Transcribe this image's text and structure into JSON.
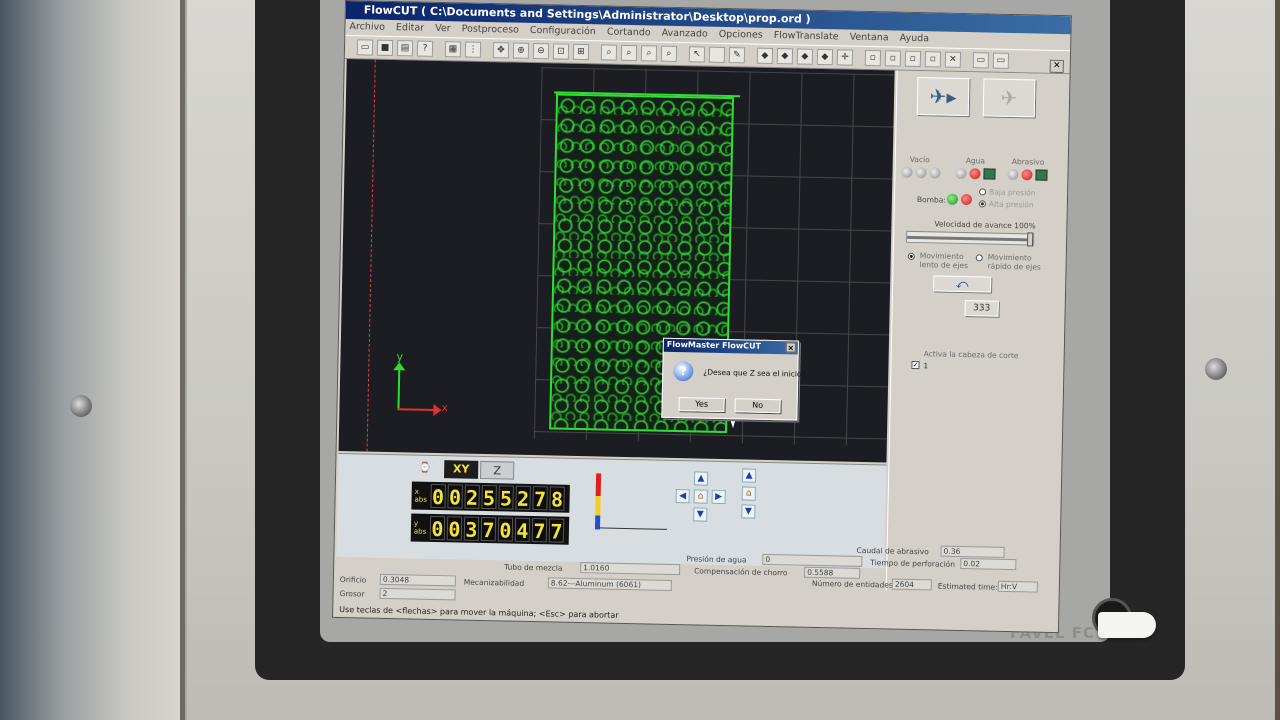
{
  "app": {
    "title": "FlowCUT ( C:\\Documents and Settings\\Administrator\\Desktop\\prop.ord )"
  },
  "menu": [
    "Archivo",
    "Editar",
    "Ver",
    "Postproceso",
    "Configuración",
    "Cortando",
    "Avanzado",
    "Opciones",
    "FlowTranslate",
    "Ventana",
    "Ayuda"
  ],
  "canvas": {
    "axis_y": "y",
    "axis_x": "x"
  },
  "dialog": {
    "title": "FlowMaster FlowCUT",
    "message": "¿Desea que Z sea el inicio?",
    "yes_label": "Yes",
    "no_label": "No",
    "close": "×"
  },
  "panel": {
    "vacio": "Vacío",
    "agua": "Agua",
    "abrasivo": "Abrasivo",
    "bomba": "Bomba:",
    "baja_presion": "Baja presión",
    "alta_presion": "Alta presión",
    "velocidad": "Velocidad de avance 100%",
    "velocidad_value": 100,
    "mov_lento": "Movimiento lento de ejes",
    "mov_rapido": "Movimiento rápido de ejes",
    "activa": "Activa la cabeza de corte",
    "check_label": "1"
  },
  "dro": {
    "tab_xy": "XY",
    "tab_z": "Z",
    "x_label": "x abs",
    "y_label": "y abs",
    "x_digits": [
      "0",
      "0",
      "2",
      "5",
      "5",
      "2",
      "7",
      "8"
    ],
    "y_digits": [
      "0",
      "0",
      "3",
      "7",
      "0",
      "4",
      "7",
      "7"
    ]
  },
  "status": {
    "caudal_abrasivo_label": "Caudal de abrasivo",
    "caudal_abrasivo_value": "0.36",
    "presion_label": "Presión de agua",
    "presion_value": "0",
    "tiempo_perf_label": "Tiempo de perforación",
    "tiempo_perf_value": "0.02",
    "tubo_label": "Tubo de mezcla",
    "tubo_value": "1.0160",
    "compensacion_label": "Compensación de chorro",
    "compensacion_value": "0.5588",
    "entidades_label": "Número de entidades",
    "entidades_value": "2604",
    "estimated_label": "Estimated time:",
    "estimated_value": "Hr:V",
    "orificio_label": "Orificio",
    "orificio_value": "0.3048",
    "mecanizabilidad_label": "Mecanizabilidad",
    "mecanizabilidad_value": "8.62---Aluminum (6061)",
    "grosor_label": "Grosor",
    "grosor_value": "2",
    "hint": "Use teclas de <flechas> para mover la máquina; <Esc> para abortar"
  },
  "device": {
    "brand": "FAVEL FC"
  }
}
